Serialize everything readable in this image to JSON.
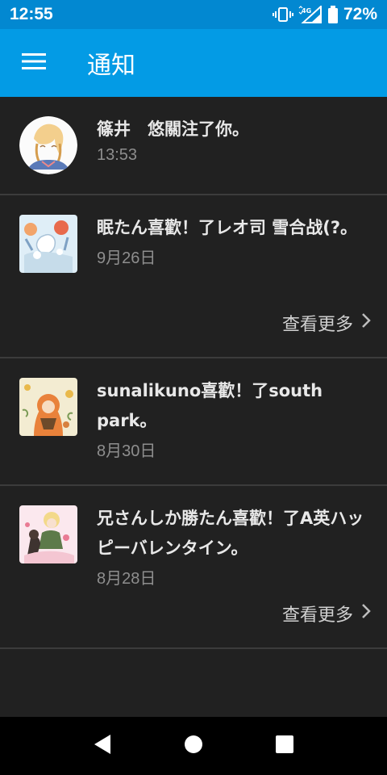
{
  "status_bar": {
    "time": "12:55",
    "network": "4G",
    "battery": "72%",
    "icons": [
      "vibrate-icon",
      "signal-icon",
      "battery-icon"
    ]
  },
  "app_bar": {
    "title": "通知",
    "menu_icon": "hamburger-menu-icon"
  },
  "notifications": [
    {
      "text": "篠井　悠關注了你。",
      "time": "13:53",
      "has_more": false,
      "avatar": "user-avatar"
    },
    {
      "text": "眠たん喜歡！了レオ司 雪合战(?。",
      "time": "9月26日",
      "has_more": true,
      "more_label": "查看更多",
      "avatar": "artwork-thumbnail"
    },
    {
      "text": "sunalikuno喜歡！了south park。",
      "time": "8月30日",
      "has_more": false,
      "avatar": "artwork-thumbnail"
    },
    {
      "text": "兄さんしか勝たん喜歡！了A英ハッピーバレンタイン。",
      "time": "8月28日",
      "has_more": true,
      "more_label": "查看更多",
      "avatar": "artwork-thumbnail"
    }
  ],
  "nav_bar": {
    "back": "back-icon",
    "home": "home-icon",
    "recents": "recents-icon"
  },
  "colors": {
    "status_bar": "#0288d1",
    "app_bar": "#039be5",
    "background": "#212121",
    "divider": "#3c3c3c"
  }
}
